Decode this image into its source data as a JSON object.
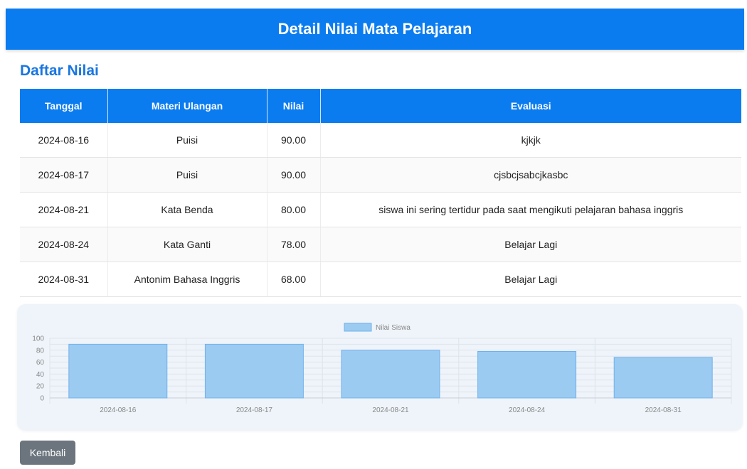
{
  "header": {
    "title": "Detail Nilai Mata Pelajaran"
  },
  "section": {
    "title": "Daftar Nilai"
  },
  "table": {
    "headers": [
      "Tanggal",
      "Materi Ulangan",
      "Nilai",
      "Evaluasi"
    ],
    "rows": [
      [
        "2024-08-16",
        "Puisi",
        "90.00",
        "kjkjk"
      ],
      [
        "2024-08-17",
        "Puisi",
        "90.00",
        "cjsbcjsabcjkasbc"
      ],
      [
        "2024-08-21",
        "Kata Benda",
        "80.00",
        "siswa ini sering tertidur pada saat mengikuti pelajaran bahasa inggris"
      ],
      [
        "2024-08-24",
        "Kata Ganti",
        "78.00",
        "Belajar Lagi"
      ],
      [
        "2024-08-31",
        "Antonim Bahasa Inggris",
        "68.00",
        "Belajar Lagi"
      ]
    ]
  },
  "chart_data": {
    "type": "bar",
    "categories": [
      "2024-08-16",
      "2024-08-17",
      "2024-08-21",
      "2024-08-24",
      "2024-08-31"
    ],
    "series": [
      {
        "name": "Nilai Siswa",
        "values": [
          90,
          90,
          80,
          78,
          68
        ]
      }
    ],
    "yticks": [
      "0",
      "20",
      "40",
      "60",
      "80",
      "100"
    ],
    "ylim": [
      0,
      100
    ],
    "grid": true,
    "legend": "top-center",
    "bar_color": "#9ccbf2",
    "bar_border": "#6fb1ea"
  },
  "actions": {
    "back_label": "Kembali"
  },
  "colors": {
    "primary": "#0a7cf0",
    "button": "#6c757d"
  }
}
